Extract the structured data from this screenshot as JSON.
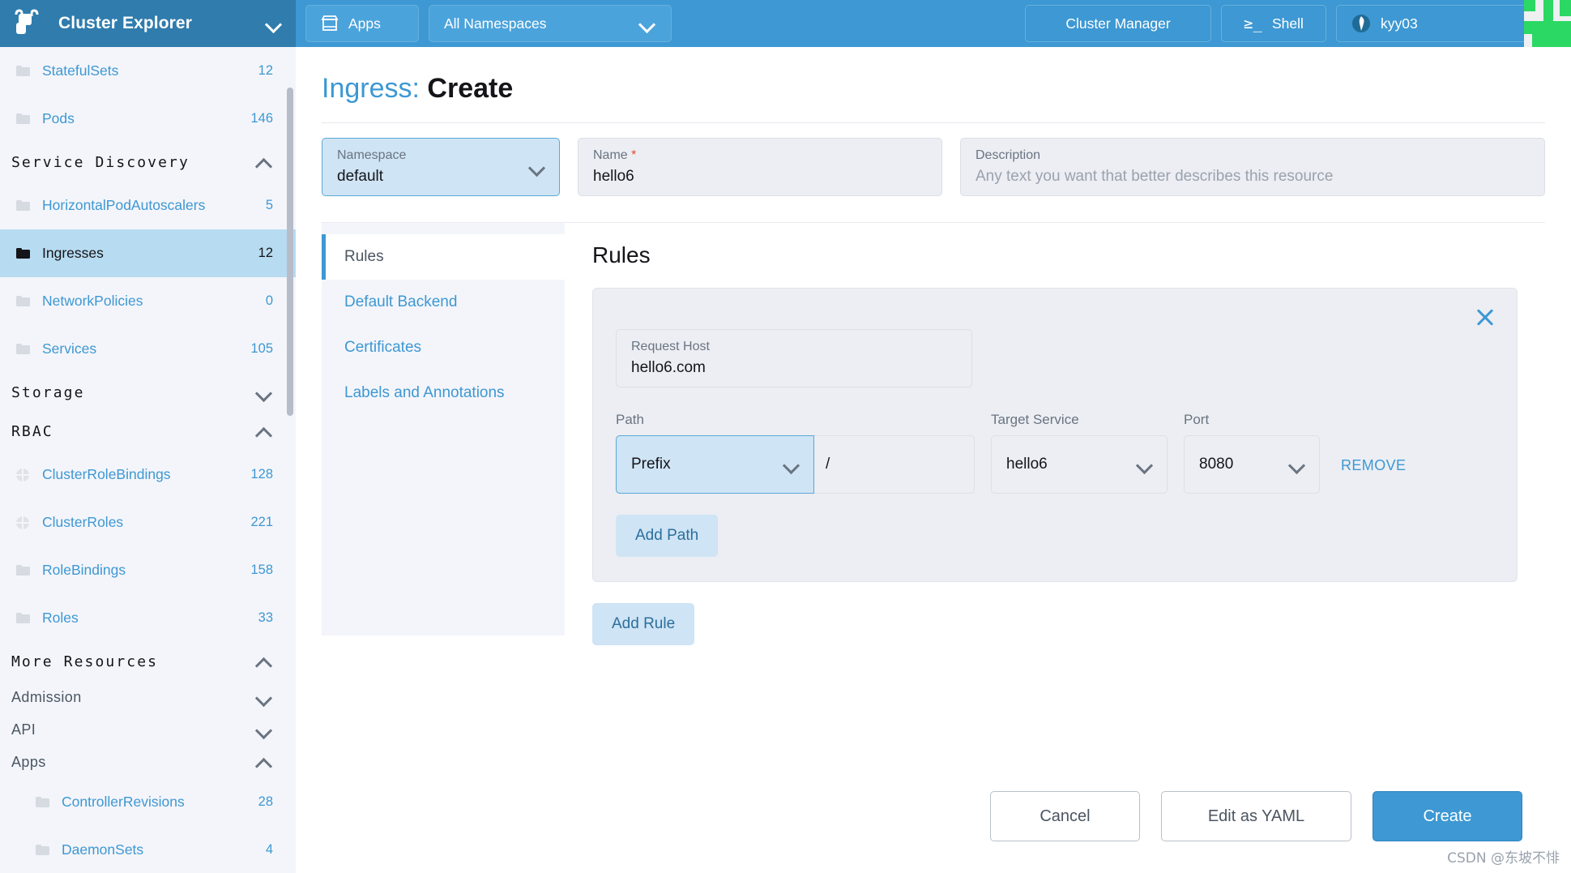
{
  "header": {
    "brand_title": "Cluster Explorer",
    "brand_icon": "rancher-cow-logo",
    "brand_chevron_icon": "chevron-down-icon",
    "apps_label": "Apps",
    "apps_icon": "store-icon",
    "namespace_label": "All Namespaces",
    "namespace_chevron_icon": "chevron-down-icon",
    "cluster_manager_label": "Cluster Manager",
    "shell_label": "Shell",
    "shell_icon": "terminal-prompt-icon",
    "cluster_name": "kyy03",
    "cluster_icon": "cluster-globe-icon",
    "cluster_chevron_icon": "chevron-down-icon",
    "accent_color": "#3d98d3",
    "brand_bg_color": "#2f7cad"
  },
  "sidebar": {
    "items": [
      {
        "type": "nav",
        "label": "StatefulSets",
        "count": "12",
        "icon": "folder-icon",
        "active": false
      },
      {
        "type": "nav",
        "label": "Pods",
        "count": "146",
        "icon": "folder-icon",
        "active": false
      },
      {
        "type": "group",
        "label": "Service Discovery",
        "chevron": "chevron-up-icon"
      },
      {
        "type": "nav",
        "label": "HorizontalPodAutoscalers",
        "count": "5",
        "icon": "folder-icon",
        "active": false
      },
      {
        "type": "nav",
        "label": "Ingresses",
        "count": "12",
        "icon": "folder-icon",
        "active": true
      },
      {
        "type": "nav",
        "label": "NetworkPolicies",
        "count": "0",
        "icon": "folder-icon",
        "active": false
      },
      {
        "type": "nav",
        "label": "Services",
        "count": "105",
        "icon": "folder-icon",
        "active": false
      },
      {
        "type": "group",
        "label": "Storage",
        "chevron": "chevron-down-icon"
      },
      {
        "type": "group",
        "label": "RBAC",
        "chevron": "chevron-up-icon"
      },
      {
        "type": "nav",
        "label": "ClusterRoleBindings",
        "count": "128",
        "icon": "globe-icon",
        "active": false
      },
      {
        "type": "nav",
        "label": "ClusterRoles",
        "count": "221",
        "icon": "globe-icon",
        "active": false
      },
      {
        "type": "nav",
        "label": "RoleBindings",
        "count": "158",
        "icon": "folder-icon",
        "active": false
      },
      {
        "type": "nav",
        "label": "Roles",
        "count": "33",
        "icon": "folder-icon",
        "active": false
      },
      {
        "type": "group",
        "label": "More Resources",
        "chevron": "chevron-up-icon"
      },
      {
        "type": "sub",
        "label": "Admission",
        "chevron": "chevron-down-icon"
      },
      {
        "type": "sub",
        "label": "API",
        "chevron": "chevron-down-icon"
      },
      {
        "type": "sub",
        "label": "Apps",
        "chevron": "chevron-up-icon"
      },
      {
        "type": "nav",
        "label": "ControllerRevisions",
        "count": "28",
        "icon": "folder-icon",
        "active": false,
        "deep": true
      },
      {
        "type": "nav",
        "label": "DaemonSets",
        "count": "4",
        "icon": "folder-icon",
        "active": false,
        "deep": true
      }
    ],
    "active_highlight_color": "#b7dbf0"
  },
  "page": {
    "title_prefix": "Ingress:",
    "title_suffix": "Create"
  },
  "form": {
    "namespace": {
      "label": "Namespace",
      "value": "default",
      "chevron": "chevron-down-icon"
    },
    "name": {
      "label": "Name",
      "required": true,
      "value": "hello6"
    },
    "description": {
      "label": "Description",
      "placeholder": "Any text you want that better describes this resource",
      "value": ""
    }
  },
  "tabs": [
    {
      "label": "Rules",
      "active": true
    },
    {
      "label": "Default Backend",
      "active": false
    },
    {
      "label": "Certificates",
      "active": false
    },
    {
      "label": "Labels and Annotations",
      "active": false
    }
  ],
  "rules_section": {
    "title": "Rules",
    "close_icon": "close-x-icon",
    "request_host": {
      "label": "Request Host",
      "value": "hello6.com"
    },
    "path_label": "Path",
    "target_service_label": "Target Service",
    "port_label": "Port",
    "path_type": "Prefix",
    "path_value": "/",
    "target_service": "hello6",
    "port": "8080",
    "remove_label": "REMOVE",
    "add_path_label": "Add Path",
    "add_rule_label": "Add Rule"
  },
  "footer": {
    "cancel_label": "Cancel",
    "yaml_label": "Edit as YAML",
    "create_label": "Create",
    "create_color": "#3d98d3"
  },
  "watermark": "CSDN @东坡不悱"
}
